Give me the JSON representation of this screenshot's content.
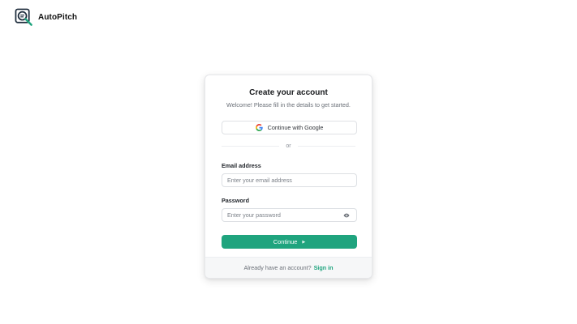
{
  "brand": {
    "name": "AutoPitch",
    "logo_icon": "magnifier-document-logo"
  },
  "card": {
    "title": "Create your account",
    "subtitle": "Welcome! Please fill in the details to get started.",
    "google_button": "Continue with Google",
    "divider": "or",
    "email": {
      "label": "Email address",
      "placeholder": "Enter your email address",
      "value": ""
    },
    "password": {
      "label": "Password",
      "placeholder": "Enter your password",
      "value": "",
      "toggle_icon": "eye-icon"
    },
    "continue_button": "Continue",
    "continue_icon": "caret-right-icon",
    "footer": {
      "text": "Already have an account?",
      "link": "Sign in"
    }
  },
  "colors": {
    "accent": "#1fa47e",
    "footer_bg": "#f6f7f8",
    "border": "#dfe1e5"
  }
}
